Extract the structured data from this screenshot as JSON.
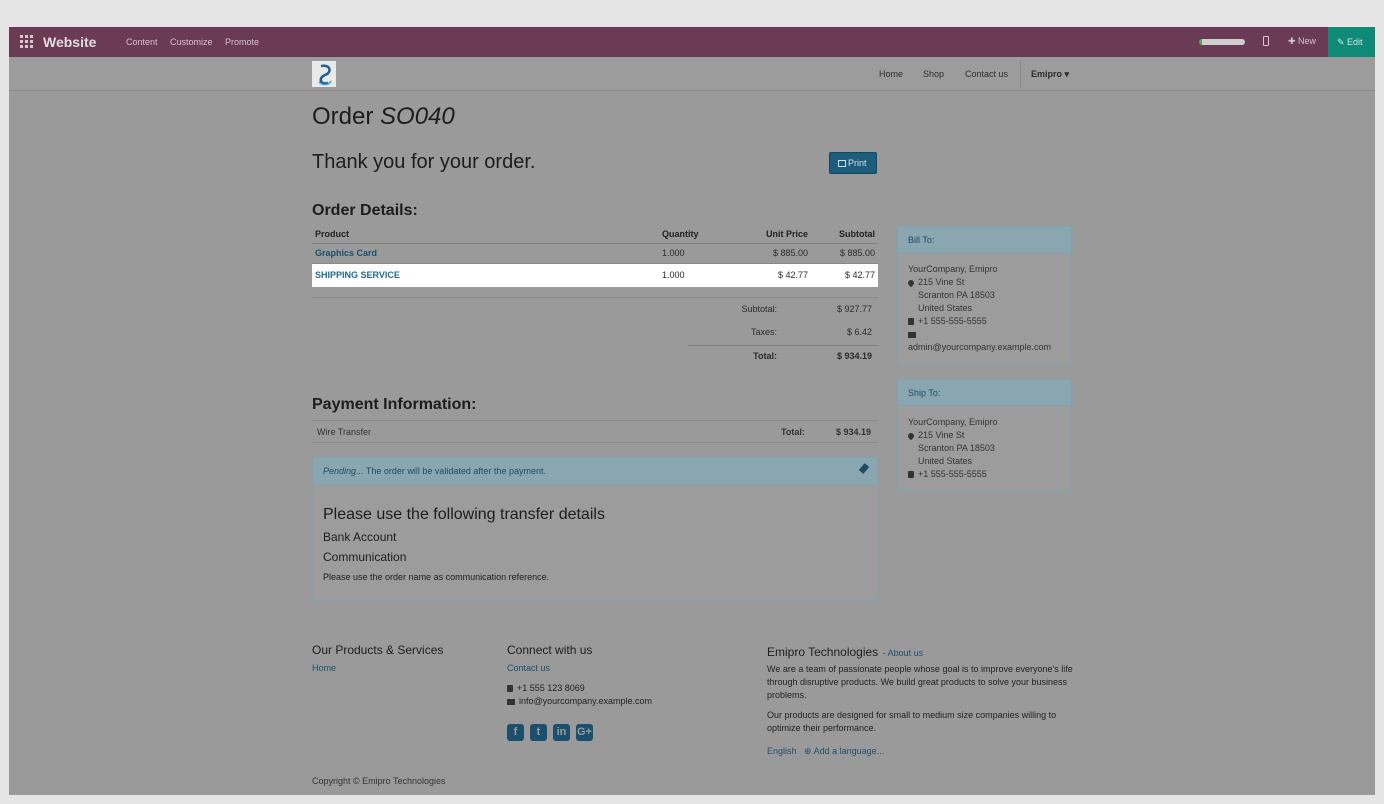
{
  "admin_bar": {
    "brand": "Website",
    "menu": [
      "Content",
      "Customize",
      "Promote"
    ],
    "new_label": "New",
    "edit_label": "Edit"
  },
  "navbar": {
    "items": [
      "Home",
      "Shop",
      "Contact us"
    ],
    "user": "Emipro"
  },
  "order": {
    "title_prefix": "Order",
    "reference": "SO040",
    "thanks": "Thank you for your order.",
    "print_label": "Print"
  },
  "details": {
    "heading": "Order Details:",
    "columns": {
      "product": "Product",
      "quantity": "Quantity",
      "unit_price": "Unit Price",
      "subtotal": "Subtotal"
    },
    "lines": [
      {
        "product": "Graphics Card",
        "quantity": "1.000",
        "unit_price": "$ 885.00",
        "subtotal": "$ 885.00"
      },
      {
        "product": "SHIPPING SERVICE",
        "quantity": "1.000",
        "unit_price": "$ 42.77",
        "subtotal": "$ 42.77"
      }
    ],
    "subtotal_label": "Subtotal:",
    "subtotal_value": "$ 927.77",
    "taxes_label": "Taxes:",
    "taxes_value": "$ 6.42",
    "total_label": "Total:",
    "total_value": "$ 934.19"
  },
  "payment": {
    "heading": "Payment Information:",
    "method": "Wire Transfer",
    "total_label": "Total:",
    "total_value": "$ 934.19",
    "status_em": "Pending...",
    "status_text": " The order will be validated after the payment.",
    "transfer_title": "Please use the following transfer details",
    "bank_account": "Bank Account",
    "communication": "Communication",
    "note": "Please use the order name as communication reference."
  },
  "bill_to": {
    "heading": "Bill To:",
    "name": "YourCompany, Emipro",
    "street": "215 Vine St",
    "city": "Scranton PA 18503",
    "country": "United States",
    "phone": "+1 555-555-5555",
    "email": "admin@yourcompany.example.com"
  },
  "ship_to": {
    "heading": "Ship To:",
    "name": "YourCompany, Emipro",
    "street": "215 Vine St",
    "city": "Scranton PA 18503",
    "country": "United States",
    "phone": "+1 555-555-5555"
  },
  "footer": {
    "products_heading": "Our Products & Services",
    "products_link": "Home",
    "connect_heading": "Connect with us",
    "contact_link": "Contact us",
    "phone": "+1 555 123 8069",
    "email": "info@yourcompany.example.com",
    "social": [
      "f",
      "t",
      "in",
      "G+"
    ],
    "company_heading": "Emipro Technologies",
    "about_link": "- About us",
    "about_p1": "We are a team of passionate people whose goal is to improve everyone's life through disruptive products. We build great products to solve your business problems.",
    "about_p2": "Our products are designed for small to medium size companies willing to optimize their performance.",
    "lang": "English",
    "add_lang": "Add a language...",
    "copyright": "Copyright © Emipro Technologies"
  }
}
